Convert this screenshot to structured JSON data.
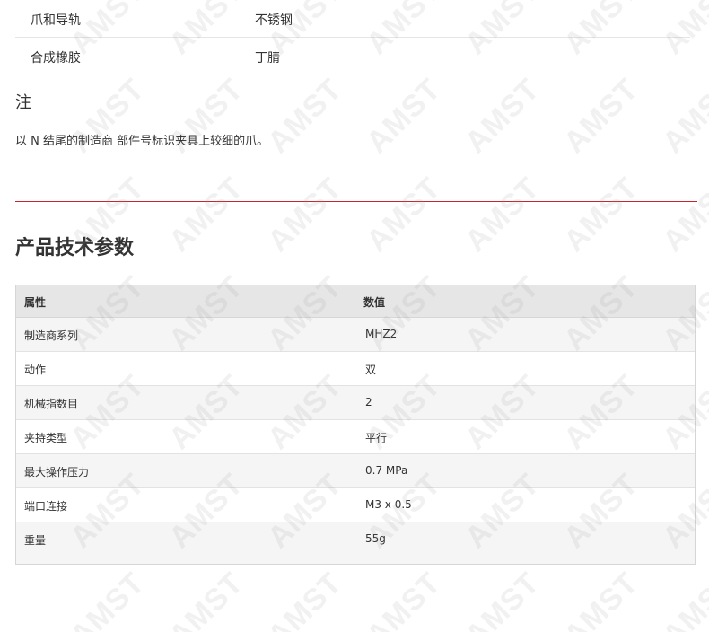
{
  "materials": [
    {
      "key": "爪和导轨",
      "value": "不锈钢"
    },
    {
      "key": "合成橡胶",
      "value": "丁腈"
    }
  ],
  "note": {
    "heading": "注",
    "text": "以 N 结尾的制造商 部件号标识夹具上较细的爪。"
  },
  "section": {
    "title": "产品技术参数"
  },
  "specs": {
    "headers": [
      "属性",
      "数值"
    ],
    "rows": [
      {
        "attr": "制造商系列",
        "value": "MHZ2"
      },
      {
        "attr": "动作",
        "value": "双"
      },
      {
        "attr": "机械指数目",
        "value": "2"
      },
      {
        "attr": "夹持类型",
        "value": "平行"
      },
      {
        "attr": "最大操作压力",
        "value": "0.7 MPa"
      },
      {
        "attr": "端口连接",
        "value": "M3 x 0.5"
      },
      {
        "attr": "重量",
        "value": "55g"
      }
    ]
  },
  "watermark": {
    "text": "AMST"
  },
  "colors": {
    "divider": "#c9242b",
    "header_bg": "#e6e6e6",
    "row_alt_bg": "#f5f5f5"
  }
}
